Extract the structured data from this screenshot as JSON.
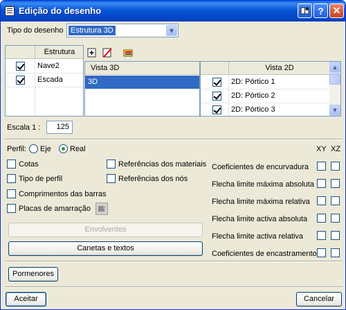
{
  "window": {
    "title": "Edição do desenho",
    "help_label": "?",
    "close_label": "✕"
  },
  "drawing_type": {
    "label": "Tipo do desenho",
    "value": "Estrutura 3D"
  },
  "estrutura_list": {
    "header": "Estrutura",
    "items": [
      {
        "label": "Nave2",
        "checked": true
      },
      {
        "label": "Escada",
        "checked": true
      }
    ]
  },
  "vista3d_list": {
    "header": "Vista 3D",
    "items": [
      {
        "label": "3D",
        "selected": true
      }
    ]
  },
  "vista2d_list": {
    "header": "Vista 2D",
    "items": [
      {
        "label": "2D: Pórtico 1",
        "checked": true
      },
      {
        "label": "2D: Pórtico 2",
        "checked": true
      },
      {
        "label": "2D: Pórtico 3",
        "checked": true
      }
    ]
  },
  "escala": {
    "label": "Escala  1 :",
    "value": "125"
  },
  "perfil": {
    "label": "Perfil:",
    "options": [
      {
        "label": "Eje",
        "selected": false
      },
      {
        "label": "Real",
        "selected": true
      }
    ]
  },
  "left_options": [
    {
      "label": "Cotas",
      "checked": false
    },
    {
      "label": "Tipo de perfil",
      "checked": false
    },
    {
      "label": "Comprimentos das barras",
      "checked": false
    },
    {
      "label": "Placas de amarração",
      "checked": false
    }
  ],
  "middle_options": [
    {
      "label": "Referências dos materiais",
      "checked": false
    },
    {
      "label": "Referências dos nós",
      "checked": false
    }
  ],
  "right_options": {
    "col_headers": [
      "XY",
      "XZ"
    ],
    "rows": [
      {
        "label": "Coeficientes de encurvadura",
        "xy": false,
        "xz": false
      },
      {
        "label": "Flecha limite máxima absoluta",
        "xy": false,
        "xz": false
      },
      {
        "label": "Flecha limite máxima relativa",
        "xy": false,
        "xz": false
      },
      {
        "label": "Flecha limite activa absoluta",
        "xy": false,
        "xz": false
      },
      {
        "label": "Flecha limite activa relativa",
        "xy": false,
        "xz": false
      },
      {
        "label": "Coeficientes de encastramento",
        "xy": false,
        "xz": false
      }
    ]
  },
  "buttons": {
    "envolventes": "Envolventes",
    "canetas": "Canetas e textos",
    "pormenores": "Pormenores",
    "aceitar": "Aceitar",
    "cancelar": "Cancelar"
  },
  "colors": {
    "selection": "#316ac5",
    "window_bg": "#ece9d8",
    "titlebar": "#0756d8"
  }
}
